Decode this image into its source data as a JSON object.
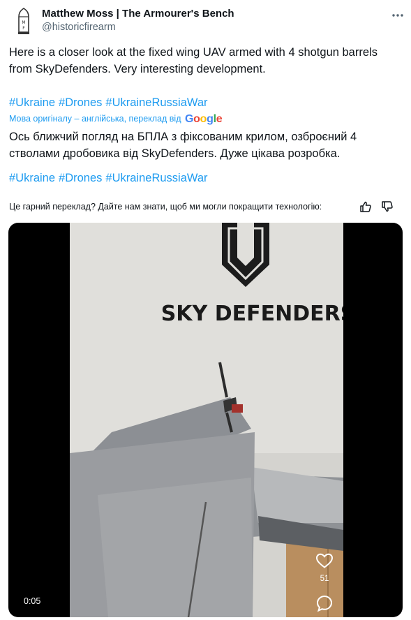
{
  "author": {
    "name": "Matthew Moss | The Armourer's Bench",
    "handle": "@historicfirearm",
    "avatar_icon": "cartridge-logo-icon"
  },
  "post": {
    "text": "Here is a closer look at the fixed wing UAV armed with 4 shotgun barrels from SkyDefenders. Very interesting development.",
    "hashtags": [
      "#Ukraine",
      "#Drones",
      "#UkraineRussiaWar"
    ],
    "translation_note": "Мова оригіналу – англійська, переклад від",
    "translation_provider": "Google",
    "translated_text": "Ось ближчий погляд на БПЛА з фіксованим крилом, озброєний 4 стволами дробовика від SkyDefenders. Дуже цікава розробка.",
    "translated_hashtags": [
      "#Ukraine",
      "#Drones",
      "#UkraineRussiaWar"
    ],
    "feedback_question": "Це гарний переклад? Дайте нам знати, щоб ми могли покращити технологію:"
  },
  "video": {
    "wall_text": "SKY DEFENDERS",
    "time": "0:05",
    "like_count": "51"
  },
  "colors": {
    "link": "#1d9bf0",
    "secondary_text": "#536471",
    "text": "#0f1419"
  },
  "icons": [
    "more-icon",
    "thumbs-up-icon",
    "thumbs-down-icon",
    "heart-icon",
    "comment-icon"
  ]
}
